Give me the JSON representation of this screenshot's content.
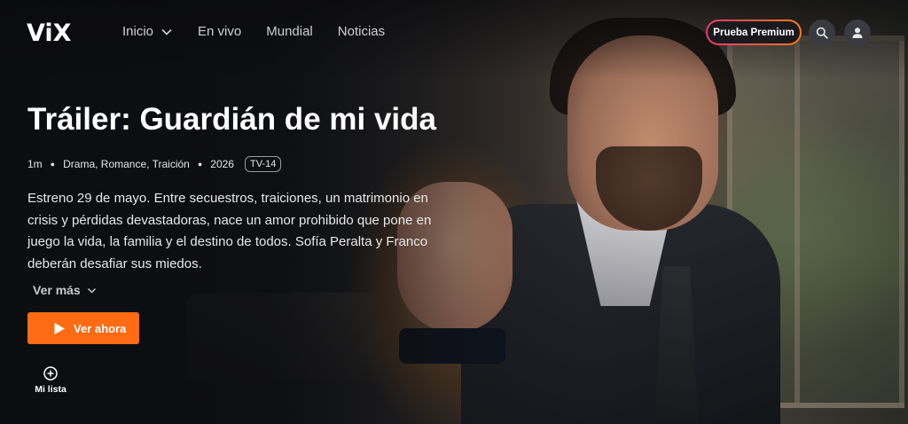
{
  "header": {
    "logo": "ViX",
    "nav": [
      {
        "label": "Inicio"
      },
      {
        "label": "En vivo"
      },
      {
        "label": "Mundial"
      },
      {
        "label": "Noticias"
      }
    ],
    "premium_label": "Prueba Premium",
    "icons": {
      "search": "search-icon",
      "profile": "user-icon",
      "dropdown": "chevron-down-icon"
    }
  },
  "hero": {
    "title": "Tráiler: Guardián de mi vida",
    "duration": "1m",
    "genres": "Drama, Romance, Traición",
    "year": "2026",
    "rating": "TV-14",
    "description": "Estreno 29 de mayo. Entre secuestros, traiciones, un matrimonio en crisis y pérdidas devastadoras, nace un amor prohibido que pone en juego la vida, la familia y el destino de todos. Sofía Peralta y Franco deberán desafiar sus miedos.",
    "more_label": "Ver más",
    "watch_label": "Ver ahora",
    "mylist_label": "Mi lista"
  },
  "colors": {
    "accent": "#ff6b13",
    "premium_gradient_start": "#e8386e",
    "premium_gradient_end": "#ff7a1a"
  }
}
